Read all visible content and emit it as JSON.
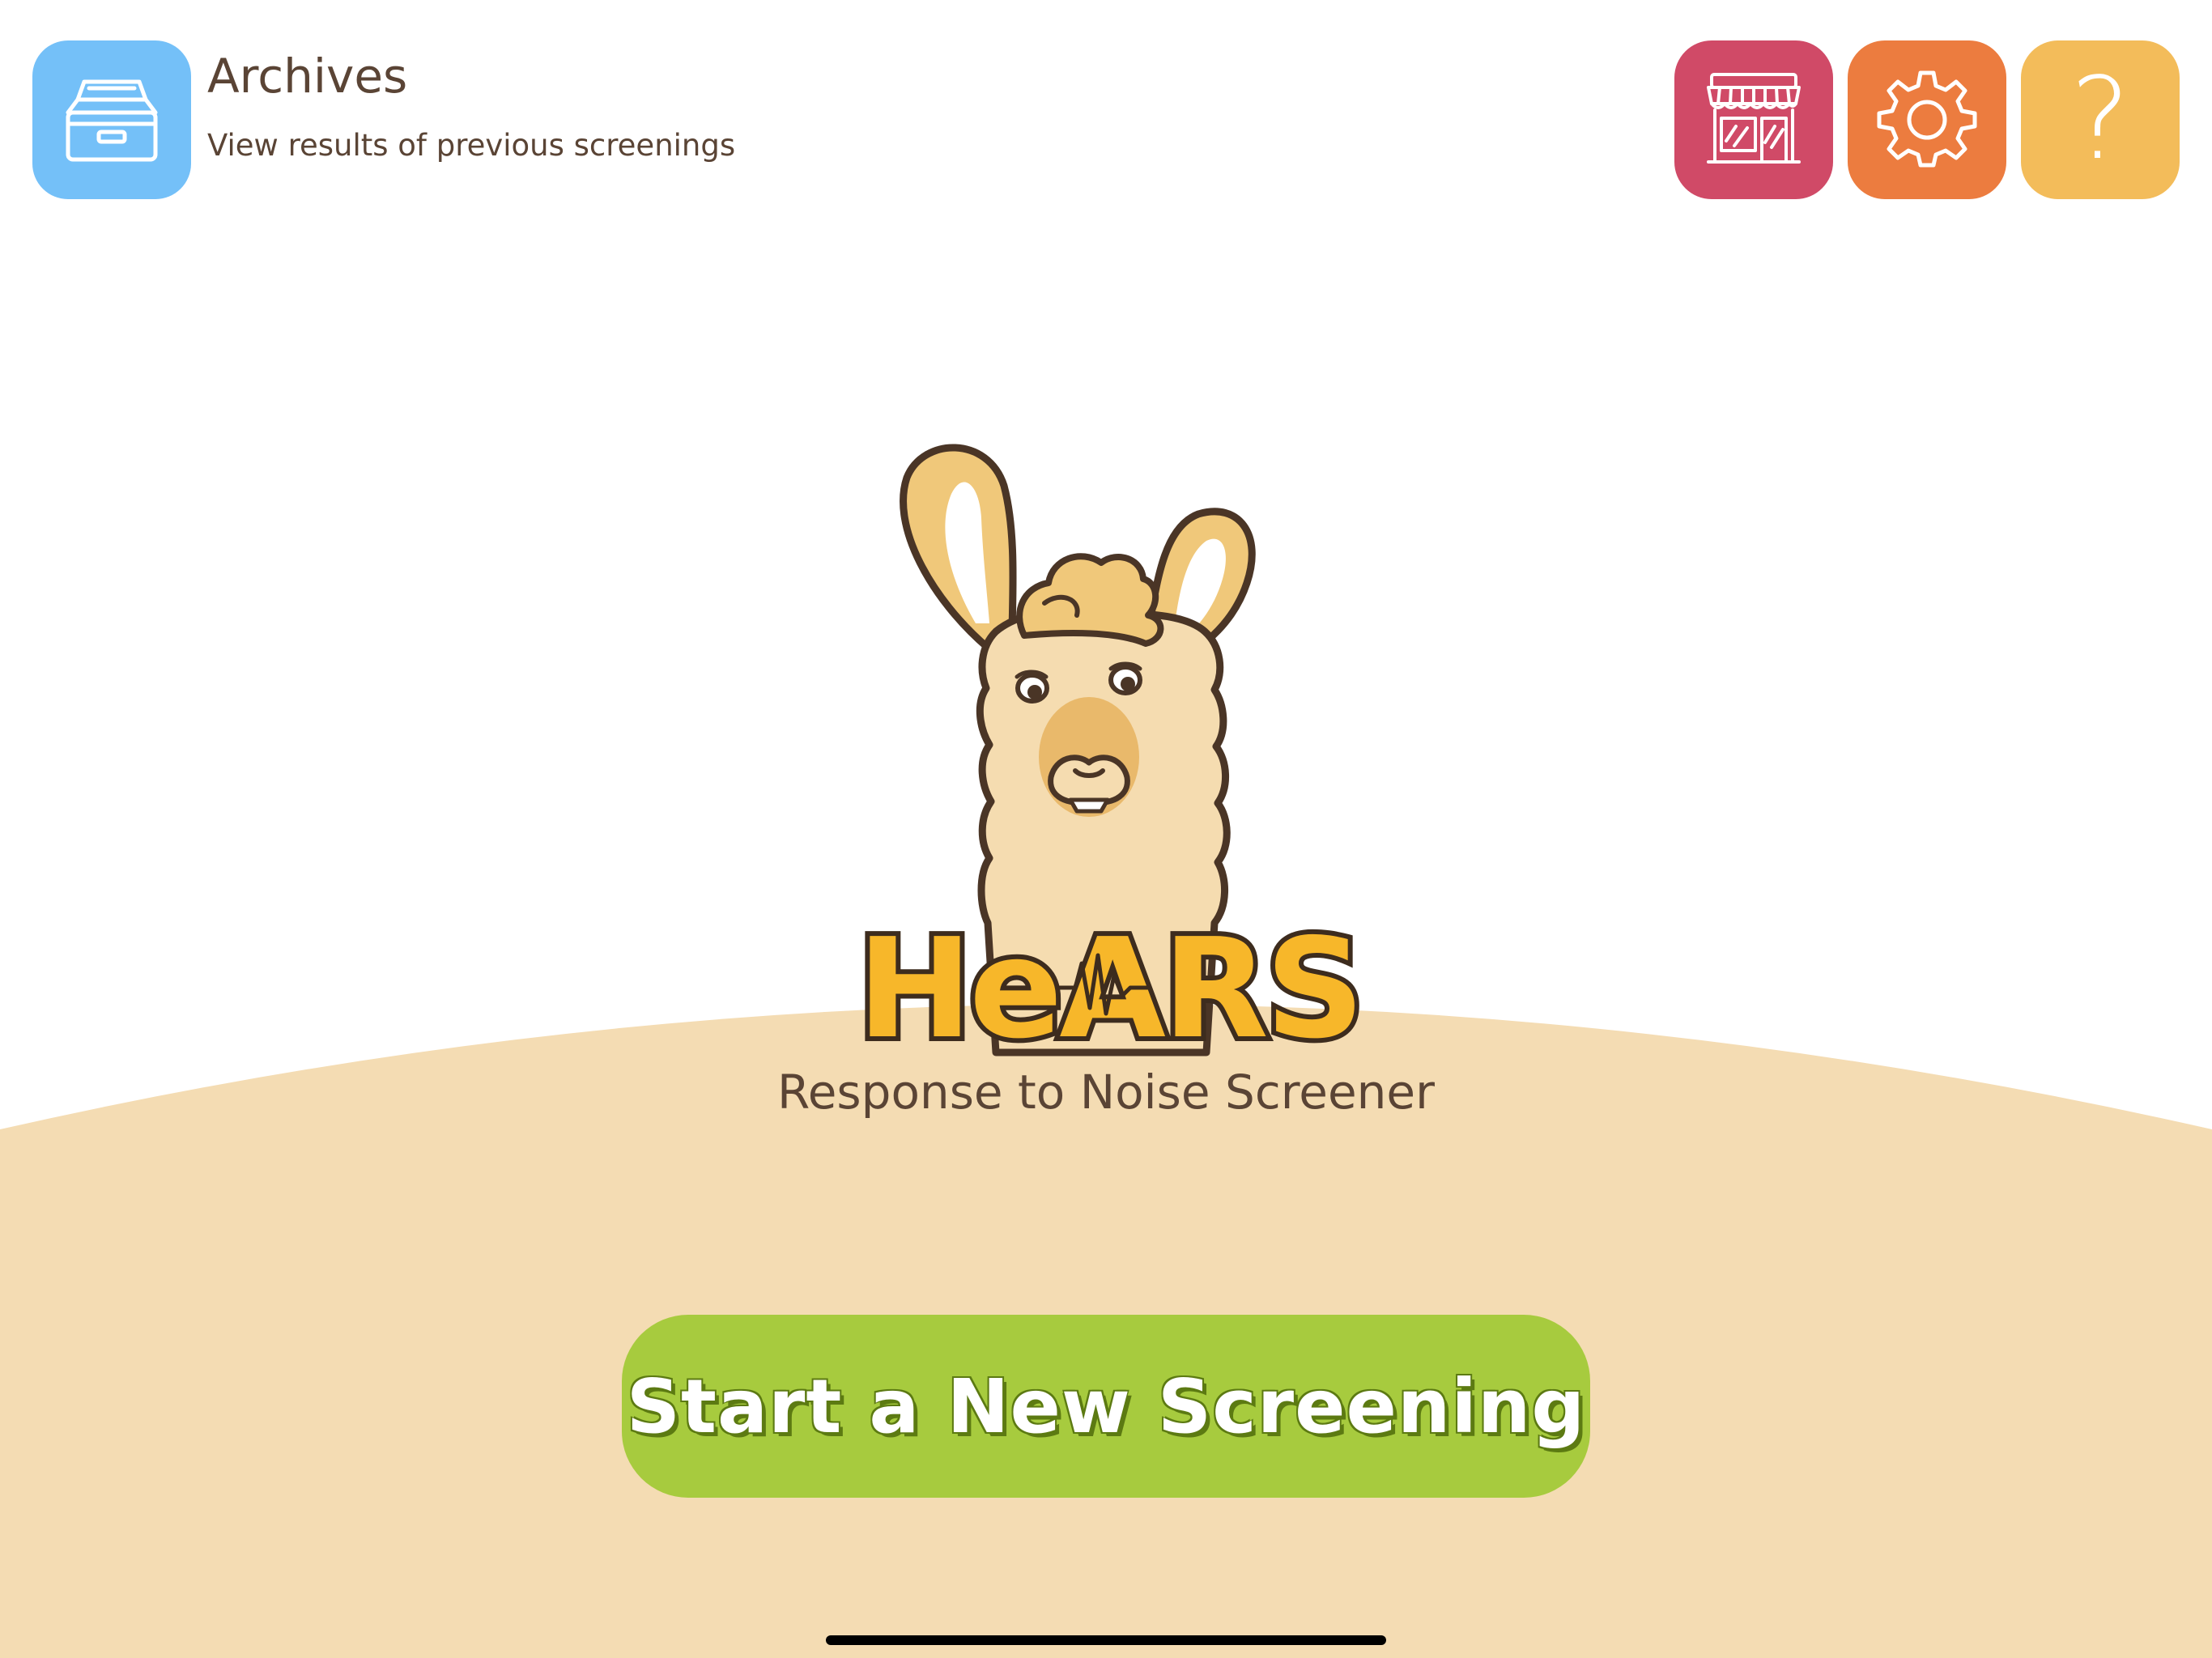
{
  "archives": {
    "title": "Archives",
    "subtitle": "View results of previous screenings",
    "icon": "archive-drawer-icon",
    "color": "#74c0f8"
  },
  "toolbar": {
    "store_icon": "storefront-icon",
    "settings_icon": "gear-icon",
    "help_label": "?",
    "store_color": "#d04a67",
    "settings_color": "#ec7c3f",
    "help_color": "#f3bc5a"
  },
  "logo": {
    "wordmark": "HeARS",
    "mascot": "llama-mascot"
  },
  "app_subtitle": "Response to Noise Screener",
  "start_button": {
    "label": "Start a New Screening",
    "color": "#a7cb3e"
  },
  "colors": {
    "hill": "#f4dcb3",
    "text": "#5a4435"
  }
}
